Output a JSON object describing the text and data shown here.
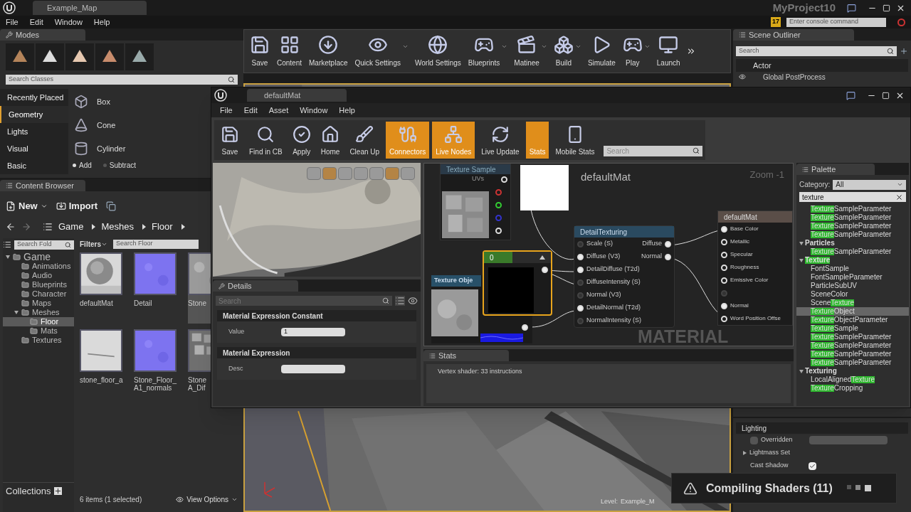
{
  "main": {
    "tab": "Example_Map",
    "project": "MyProject10",
    "menu": [
      "File",
      "Edit",
      "Window",
      "Help"
    ],
    "notifications": "17",
    "console_placeholder": "Enter console command"
  },
  "modes": {
    "title": "Modes",
    "search_placeholder": "Search Classes",
    "categories": [
      {
        "label": "Recently Placed",
        "selected": false
      },
      {
        "label": "Geometry",
        "selected": true
      },
      {
        "label": "Lights",
        "selected": false
      },
      {
        "label": "Visual",
        "selected": false
      },
      {
        "label": "Basic",
        "selected": false
      }
    ],
    "items": [
      "Box",
      "Cone",
      "Cylinder"
    ],
    "brush": [
      {
        "label": "Add",
        "selected": true
      },
      {
        "label": "Subtract",
        "selected": false
      }
    ]
  },
  "toolbar": [
    {
      "label": "Save",
      "dropdown": false
    },
    {
      "label": "Content",
      "dropdown": false
    },
    {
      "label": "Marketplace",
      "dropdown": false
    },
    {
      "label": "Quick Settings",
      "dropdown": true
    },
    {
      "label": "World Settings",
      "dropdown": false
    },
    {
      "label": "Blueprints",
      "dropdown": true
    },
    {
      "label": "Matinee",
      "dropdown": true
    },
    {
      "label": "Build",
      "dropdown": true
    },
    {
      "label": "Simulate",
      "dropdown": false
    },
    {
      "label": "Play",
      "dropdown": true
    },
    {
      "label": "Launch",
      "dropdown": false
    }
  ],
  "scene_outliner": {
    "title": "Scene Outliner",
    "search_placeholder": "Search",
    "column": "Actor",
    "rows": [
      "Global PostProcess"
    ]
  },
  "content_browser": {
    "title": "Content Browser",
    "new": "New",
    "import": "Import",
    "path": [
      "Game",
      "Meshes",
      "Floor"
    ],
    "folder_search_placeholder": "Search Fold",
    "filters": "Filters",
    "asset_search_placeholder": "Search Floor",
    "tree": [
      {
        "label": "Game",
        "expanded": true,
        "selected": false,
        "children": [
          {
            "label": "Animations",
            "selected": false
          },
          {
            "label": "Audio",
            "selected": false
          },
          {
            "label": "Blueprints",
            "selected": false
          },
          {
            "label": "Character",
            "selected": false
          },
          {
            "label": "Maps",
            "selected": false
          },
          {
            "label": "Meshes",
            "expanded": true,
            "selected": false,
            "children": [
              {
                "label": "Floor",
                "selected": true
              },
              {
                "label": "Mats",
                "selected": false
              }
            ]
          },
          {
            "label": "Textures",
            "selected": false
          }
        ]
      }
    ],
    "assets": [
      {
        "name": "defaultMat",
        "kind": "sphere",
        "selected": false
      },
      {
        "name": "Detail",
        "kind": "normal",
        "selected": false
      },
      {
        "name": "Stone",
        "kind": "stone",
        "selected": true
      },
      {
        "name": "stone_floor_a",
        "kind": "mesh",
        "selected": false
      },
      {
        "name": "Stone_Floor_ A1_normals",
        "kind": "normal",
        "selected": false
      },
      {
        "name": "Stone A_Dif",
        "kind": "cobble",
        "selected": false
      }
    ],
    "collections": "Collections",
    "status": "6 items (1 selected)",
    "view_options": "View Options"
  },
  "viewport": {
    "level_label": "Level:",
    "level_name": "Example_M"
  },
  "details": {
    "section": "Lighting",
    "rows": [
      {
        "kind": "checkbox",
        "label": "Overridden",
        "checked": false
      },
      {
        "kind": "group",
        "label": "Lightmass Set",
        "expanded": false
      },
      {
        "kind": "checkbox",
        "label": "Cast Shadow",
        "checked": true
      }
    ]
  },
  "material_editor": {
    "tab": "defaultMat",
    "menu": [
      "File",
      "Edit",
      "Asset",
      "Window",
      "Help"
    ],
    "toolbar": [
      {
        "label": "Save",
        "active": false
      },
      {
        "label": "Find in CB",
        "active": false
      },
      {
        "label": "Apply",
        "active": false
      },
      {
        "label": "Home",
        "active": false
      },
      {
        "label": "Clean Up",
        "active": false
      },
      {
        "label": "Connectors",
        "active": true
      },
      {
        "label": "Live Nodes",
        "active": true
      },
      {
        "label": "Live Update",
        "active": false
      },
      {
        "label": "Stats",
        "active": true
      },
      {
        "label": "Mobile Stats",
        "active": false
      }
    ],
    "search_placeholder": "Search",
    "preview_toggles": [
      {
        "on": false
      },
      {
        "on": true
      },
      {
        "on": false
      },
      {
        "on": false
      },
      {
        "on": false
      },
      {
        "on": true
      },
      {
        "on": false
      }
    ],
    "details": {
      "title": "Details",
      "search_placeholder": "Search",
      "sections": [
        {
          "title": "Material Expression Constant",
          "label": "Value",
          "value": "1"
        },
        {
          "title": "Material Expression",
          "label": "Desc"
        }
      ]
    },
    "graph": {
      "title": "defaultMat",
      "zoom": "Zoom -1",
      "watermark": "MATERIAL",
      "texture_sample": {
        "title": "Texture Sample",
        "pin": "UVs"
      },
      "constant": {
        "title": "0",
        "selected": true
      },
      "texture_object": {
        "title": "Texture Obje"
      },
      "detail_texturing": {
        "title": "DetailTexturing",
        "inputs": [
          {
            "label": "Scale (S)",
            "connected": false
          },
          {
            "label": "Diffuse (V3)",
            "connected": true
          },
          {
            "label": "DetailDiffuse (T2d)",
            "connected": true
          },
          {
            "label": "DiffuseIntensity (S)",
            "connected": false
          },
          {
            "label": "Normal (V3)",
            "connected": false
          },
          {
            "label": "DetailNormal (T2d)",
            "connected": true
          },
          {
            "label": "NormalIntensity (S)",
            "connected": false
          }
        ],
        "outputs": [
          "Diffuse",
          "Normal"
        ]
      },
      "result": {
        "title": "defaultMat",
        "pins": [
          {
            "label": "Base Color",
            "connected": true,
            "disabled": false
          },
          {
            "label": "Metallic",
            "connected": false,
            "disabled": false
          },
          {
            "label": "Specular",
            "connected": false,
            "disabled": false
          },
          {
            "label": "Roughness",
            "connected": false,
            "disabled": false
          },
          {
            "label": "Emissive Color",
            "connected": false,
            "disabled": false
          },
          {
            "connected": false,
            "disabled": true
          },
          {
            "label": "Normal",
            "connected": true,
            "disabled": false
          },
          {
            "label": "Word Position Offse",
            "connected": false,
            "disabled": false
          }
        ]
      }
    },
    "stats": {
      "title": "Stats",
      "lines": [
        "Vertex shader: 33 instructions"
      ]
    },
    "palette": {
      "title": "Palette",
      "category_label": "Category:",
      "category": "All",
      "search": "texture",
      "items": [
        {
          "kind": "entry",
          "selected": false,
          "parts": [
            {
              "text": "Texture",
              "match": true
            },
            {
              "text": "SampleParameter",
              "match": false
            }
          ]
        },
        {
          "kind": "entry",
          "selected": false,
          "parts": [
            {
              "text": "Texture",
              "match": true
            },
            {
              "text": "SampleParameter",
              "match": false
            }
          ]
        },
        {
          "kind": "entry",
          "selected": false,
          "parts": [
            {
              "text": "Texture",
              "match": true
            },
            {
              "text": "SampleParameter",
              "match": false
            }
          ]
        },
        {
          "kind": "entry",
          "selected": false,
          "parts": [
            {
              "text": "Texture",
              "match": true
            },
            {
              "text": "SampleParameter",
              "match": false
            }
          ]
        },
        {
          "kind": "category",
          "selected": false,
          "parts": [
            {
              "text": "Particles",
              "match": false
            }
          ]
        },
        {
          "kind": "entry",
          "selected": false,
          "parts": [
            {
              "text": "Texture",
              "match": true
            },
            {
              "text": "SampleParameter",
              "match": false
            }
          ]
        },
        {
          "kind": "category",
          "selected": false,
          "parts": [
            {
              "text": "Texture",
              "match": true
            }
          ]
        },
        {
          "kind": "entry",
          "selected": false,
          "parts": [
            {
              "text": "FontSample",
              "match": false
            }
          ]
        },
        {
          "kind": "entry",
          "selected": false,
          "parts": [
            {
              "text": "FontSampleParameter",
              "match": false
            }
          ]
        },
        {
          "kind": "entry",
          "selected": false,
          "parts": [
            {
              "text": "ParticleSubUV",
              "match": false
            }
          ]
        },
        {
          "kind": "entry",
          "selected": false,
          "parts": [
            {
              "text": "SceneColor",
              "match": false
            }
          ]
        },
        {
          "kind": "entry",
          "selected": false,
          "parts": [
            {
              "text": "Scene",
              "match": false
            },
            {
              "text": "Texture",
              "match": true
            }
          ]
        },
        {
          "kind": "entry",
          "selected": true,
          "parts": [
            {
              "text": "Texture",
              "match": true
            },
            {
              "text": "Object",
              "match": false
            }
          ]
        },
        {
          "kind": "entry",
          "selected": false,
          "parts": [
            {
              "text": "Texture",
              "match": true
            },
            {
              "text": "ObjectParameter",
              "match": false
            }
          ]
        },
        {
          "kind": "entry",
          "selected": false,
          "parts": [
            {
              "text": "Texture",
              "match": true
            },
            {
              "text": "Sample",
              "match": false
            }
          ]
        },
        {
          "kind": "entry",
          "selected": false,
          "parts": [
            {
              "text": "Texture",
              "match": true
            },
            {
              "text": "SampleParameter",
              "match": false
            }
          ]
        },
        {
          "kind": "entry",
          "selected": false,
          "parts": [
            {
              "text": "Texture",
              "match": true
            },
            {
              "text": "SampleParameter",
              "match": false
            }
          ]
        },
        {
          "kind": "entry",
          "selected": false,
          "parts": [
            {
              "text": "Texture",
              "match": true
            },
            {
              "text": "SampleParameter",
              "match": false
            }
          ]
        },
        {
          "kind": "entry",
          "selected": false,
          "parts": [
            {
              "text": "Texture",
              "match": true
            },
            {
              "text": "SampleParameter",
              "match": false
            }
          ]
        },
        {
          "kind": "category",
          "selected": false,
          "parts": [
            {
              "text": "Texturing",
              "match": false
            }
          ]
        },
        {
          "kind": "entry",
          "selected": false,
          "parts": [
            {
              "text": "LocalAligned",
              "match": false
            },
            {
              "text": "Texture",
              "match": true
            }
          ]
        },
        {
          "kind": "entry",
          "selected": false,
          "parts": [
            {
              "text": "Texture",
              "match": true
            },
            {
              "text": "Cropping",
              "match": false
            }
          ]
        }
      ]
    }
  },
  "toast": {
    "text": "Compiling Shaders (11)"
  }
}
